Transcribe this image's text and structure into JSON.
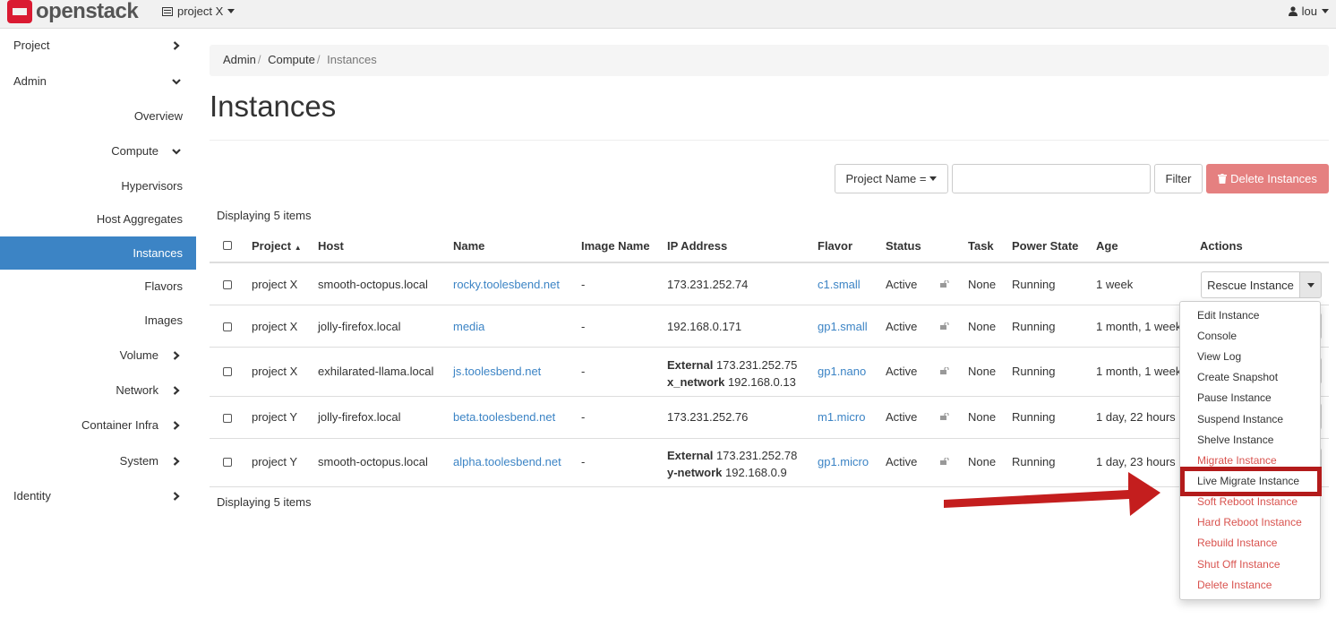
{
  "topbar": {
    "brand": "openstack",
    "project_switcher": "project X",
    "user": "lou"
  },
  "sidebar": {
    "project": "Project",
    "admin": "Admin",
    "overview": "Overview",
    "compute": "Compute",
    "hypervisors": "Hypervisors",
    "host_aggregates": "Host Aggregates",
    "instances": "Instances",
    "flavors": "Flavors",
    "images": "Images",
    "volume": "Volume",
    "network": "Network",
    "container_infra": "Container Infra",
    "system": "System",
    "identity": "Identity"
  },
  "breadcrumb": {
    "admin": "Admin",
    "compute": "Compute",
    "current": "Instances",
    "separator": "/"
  },
  "page": {
    "title": "Instances"
  },
  "filter": {
    "field_label": "Project Name =",
    "input_value": "",
    "filter_button": "Filter",
    "delete_button": "Delete Instances"
  },
  "count_top": "Displaying 5 items",
  "count_bottom": "Displaying 5 items",
  "table": {
    "headers": {
      "project": "Project",
      "host": "Host",
      "name": "Name",
      "image_name": "Image Name",
      "ip_address": "IP Address",
      "flavor": "Flavor",
      "status": "Status",
      "task": "Task",
      "power_state": "Power State",
      "age": "Age",
      "actions": "Actions"
    },
    "rows": [
      {
        "project": "project X",
        "host": "smooth-octopus.local",
        "name": "rocky.toolesbend.net",
        "image_name": "-",
        "ip": "173.231.252.74",
        "flavor": "c1.small",
        "status": "Active",
        "task": "None",
        "power_state": "Running",
        "age": "1 week"
      },
      {
        "project": "project X",
        "host": "jolly-firefox.local",
        "name": "media",
        "image_name": "-",
        "ip": "192.168.0.171",
        "flavor": "gp1.small",
        "status": "Active",
        "task": "None",
        "power_state": "Running",
        "age": "1 month, 1 week"
      },
      {
        "project": "project X",
        "host": "exhilarated-llama.local",
        "name": "js.toolesbend.net",
        "image_name": "-",
        "ip_label_1": "External",
        "ip_1": "173.231.252.75",
        "ip_label_2": "x_network",
        "ip_2": "192.168.0.13",
        "flavor": "gp1.nano",
        "status": "Active",
        "task": "None",
        "power_state": "Running",
        "age": "1 month, 1 week"
      },
      {
        "project": "project Y",
        "host": "jolly-firefox.local",
        "name": "beta.toolesbend.net",
        "image_name": "-",
        "ip": "173.231.252.76",
        "flavor": "m1.micro",
        "status": "Active",
        "task": "None",
        "power_state": "Running",
        "age": "1 day, 22 hours"
      },
      {
        "project": "project Y",
        "host": "smooth-octopus.local",
        "name": "alpha.toolesbend.net",
        "image_name": "-",
        "ip_label_1": "External",
        "ip_1": "173.231.252.78",
        "ip_label_2": "y-network",
        "ip_2": "192.168.0.9",
        "flavor": "gp1.micro",
        "status": "Active",
        "task": "None",
        "power_state": "Running",
        "age": "1 day, 23 hours"
      }
    ]
  },
  "actions": {
    "primary": "Rescue Instance",
    "menu": [
      "Edit Instance",
      "Console",
      "View Log",
      "Create Snapshot",
      "Pause Instance",
      "Suspend Instance",
      "Shelve Instance",
      "Migrate Instance",
      "Live Migrate Instance",
      "Soft Reboot Instance",
      "Hard Reboot Instance",
      "Rebuild Instance",
      "Shut Off Instance",
      "Delete Instance"
    ]
  },
  "colors": {
    "accent": "#3c84c5",
    "danger": "#d9534f",
    "highlight": "#b31b1b",
    "brand": "#da1a32"
  }
}
